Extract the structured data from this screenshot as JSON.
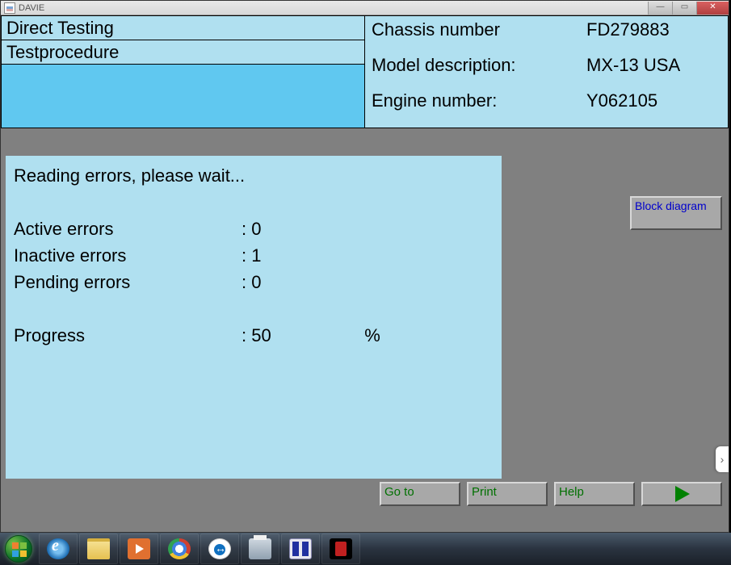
{
  "window": {
    "title": "DAVIE"
  },
  "header": {
    "left": {
      "line1": "Direct Testing",
      "line2": "Testprocedure"
    },
    "right": {
      "chassis_label": "Chassis number",
      "chassis_value": "FD279883",
      "model_label": "Model description:",
      "model_value": "MX-13 USA",
      "engine_label": "Engine number:",
      "engine_value": "Y062105"
    }
  },
  "content": {
    "status_line": "Reading errors, please wait...",
    "active_label": "Active errors",
    "active_value": "0",
    "inactive_label": "Inactive errors",
    "inactive_value": "1",
    "pending_label": "Pending errors",
    "pending_value": "0",
    "progress_label": "Progress",
    "progress_value": "50",
    "progress_unit": "%"
  },
  "buttons": {
    "block_diagram": "Block diagram",
    "goto": "Go to",
    "print": "Print",
    "help": "Help"
  }
}
